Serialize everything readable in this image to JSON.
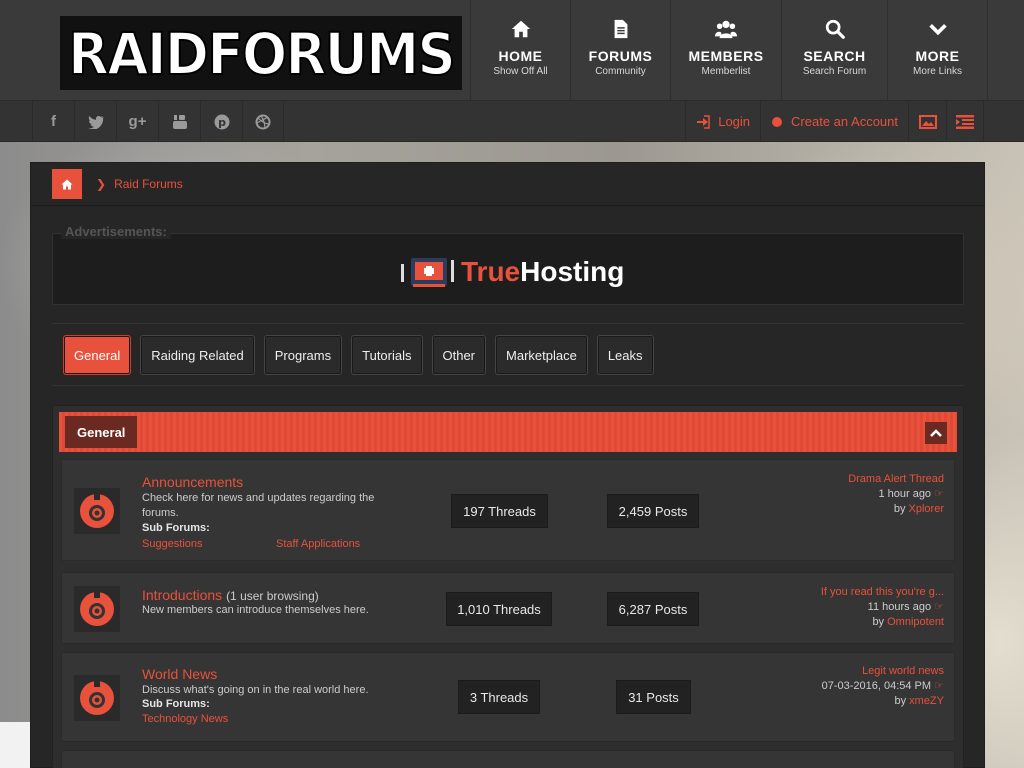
{
  "site": {
    "logo_text": "RAIDFORUMS"
  },
  "nav": [
    {
      "label": "HOME",
      "sub": "Show Off All",
      "icon": "home-icon"
    },
    {
      "label": "FORUMS",
      "sub": "Community",
      "icon": "document-icon"
    },
    {
      "label": "MEMBERS",
      "sub": "Memberlist",
      "icon": "users-icon"
    },
    {
      "label": "SEARCH",
      "sub": "Search Forum",
      "icon": "search-icon"
    },
    {
      "label": "MORE",
      "sub": "More Links",
      "icon": "chevron-down-icon"
    }
  ],
  "social": [
    "f",
    "t",
    "g+",
    "yt",
    "p",
    "d"
  ],
  "account": {
    "login": "Login",
    "register": "Create an Account"
  },
  "breadcrumb": {
    "current": "Raid Forums"
  },
  "ad": {
    "label": "Advertisements:",
    "brand_part1": "True",
    "brand_part2": "Hosting"
  },
  "tabs": [
    "General",
    "Raiding Related",
    "Programs",
    "Tutorials",
    "Other",
    "Marketplace",
    "Leaks"
  ],
  "category": {
    "title": "General"
  },
  "forums": [
    {
      "title": "Announcements",
      "browsing": "",
      "desc": "Check here for news and updates regarding the forums.",
      "subforums_label": "Sub Forums:",
      "subforums": [
        "Suggestions",
        "Staff Applications"
      ],
      "threads": "197 Threads",
      "posts": "2,459 Posts",
      "last_title": "Drama Alert Thread",
      "last_time": "1 hour ago",
      "last_by_label": "by",
      "last_by": "Xplorer"
    },
    {
      "title": "Introductions",
      "browsing": "(1 user browsing)",
      "desc": "New members can introduce themselves here.",
      "subforums_label": "",
      "subforums": [],
      "threads": "1,010 Threads",
      "posts": "6,287 Posts",
      "last_title": "If you read this you're g...",
      "last_time": "11 hours ago",
      "last_by_label": "by",
      "last_by": "Omnipotent"
    },
    {
      "title": "World News",
      "browsing": "",
      "desc": "Discuss what's going on in the real world here.",
      "subforums_label": "Sub Forums:",
      "subforums": [
        "Technology News"
      ],
      "threads": "3 Threads",
      "posts": "31 Posts",
      "last_title": "Legit world news",
      "last_time": "07-03-2016, 04:54 PM",
      "last_by_label": "by",
      "last_by": "xmeZY"
    }
  ],
  "colors": {
    "accent": "#e8513b",
    "header_bg": "#3a3a3a",
    "panel_bg": "#262626"
  }
}
